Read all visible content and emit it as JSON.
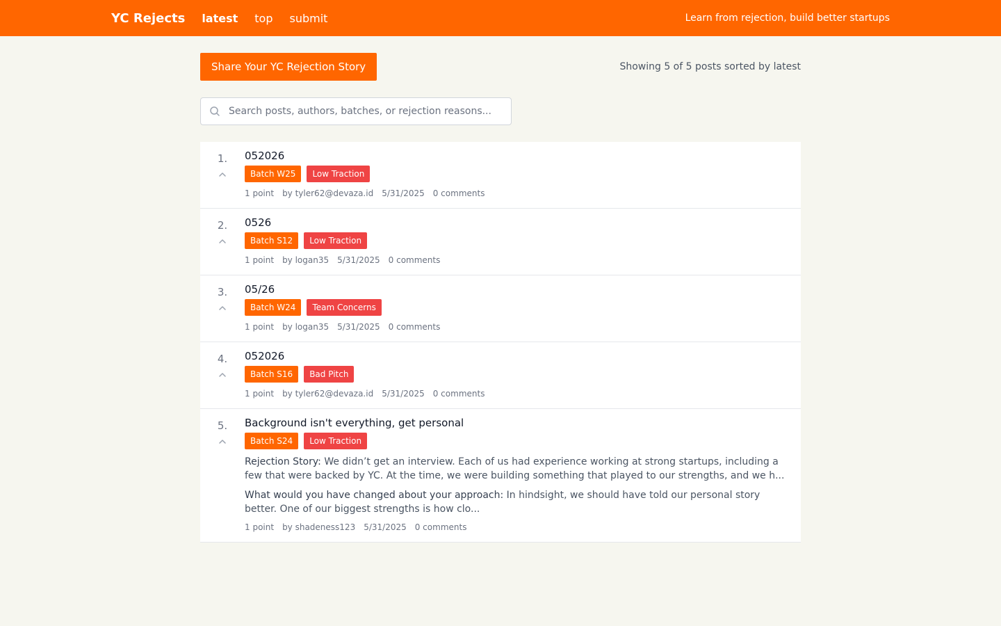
{
  "header": {
    "brand": "YC Rejects",
    "nav": [
      "latest",
      "top",
      "submit"
    ],
    "tagline": "Learn from rejection, build better startups",
    "color": "#ff6600"
  },
  "actions": {
    "share_label": "Share Your YC Rejection Story",
    "showing_text": "Showing 5 of 5 posts sorted by latest"
  },
  "search": {
    "placeholder": "Search posts, authors, batches, or rejection reasons..."
  },
  "posts": [
    {
      "rank": "1.",
      "title": "052026",
      "batch": "Batch W25",
      "reason": "Low Traction",
      "points": "1 point",
      "author": "by tyler62@devaza.id",
      "date": "5/31/2025",
      "comments": "0 comments"
    },
    {
      "rank": "2.",
      "title": "0526",
      "batch": "Batch S12",
      "reason": "Low Traction",
      "points": "1 point",
      "author": "by logan35",
      "date": "5/31/2025",
      "comments": "0 comments"
    },
    {
      "rank": "3.",
      "title": "05/26",
      "batch": "Batch W24",
      "reason": "Team Concerns",
      "points": "1 point",
      "author": "by logan35",
      "date": "5/31/2025",
      "comments": "0 comments"
    },
    {
      "rank": "4.",
      "title": "052026",
      "batch": "Batch S16",
      "reason": "Bad Pitch",
      "points": "1 point",
      "author": "by tyler62@devaza.id",
      "date": "5/31/2025",
      "comments": "0 comments"
    },
    {
      "rank": "5.",
      "title": "Background isn't everything, get personal",
      "batch": "Batch S24",
      "reason": "Low Traction",
      "story_label": "Rejection Story:",
      "story_text": "We didn’t get an interview. Each of us had experience working at strong startups, including a few that were backed by YC. At the time, we were building something that played to our strengths, and we h...",
      "changed_label": "What would you have changed about your approach:",
      "changed_text": "In hindsight, we should have told our personal story better. One of our biggest strengths is how clo...",
      "points": "1 point",
      "author": "by shadeness123",
      "date": "5/31/2025",
      "comments": "0 comments"
    }
  ]
}
